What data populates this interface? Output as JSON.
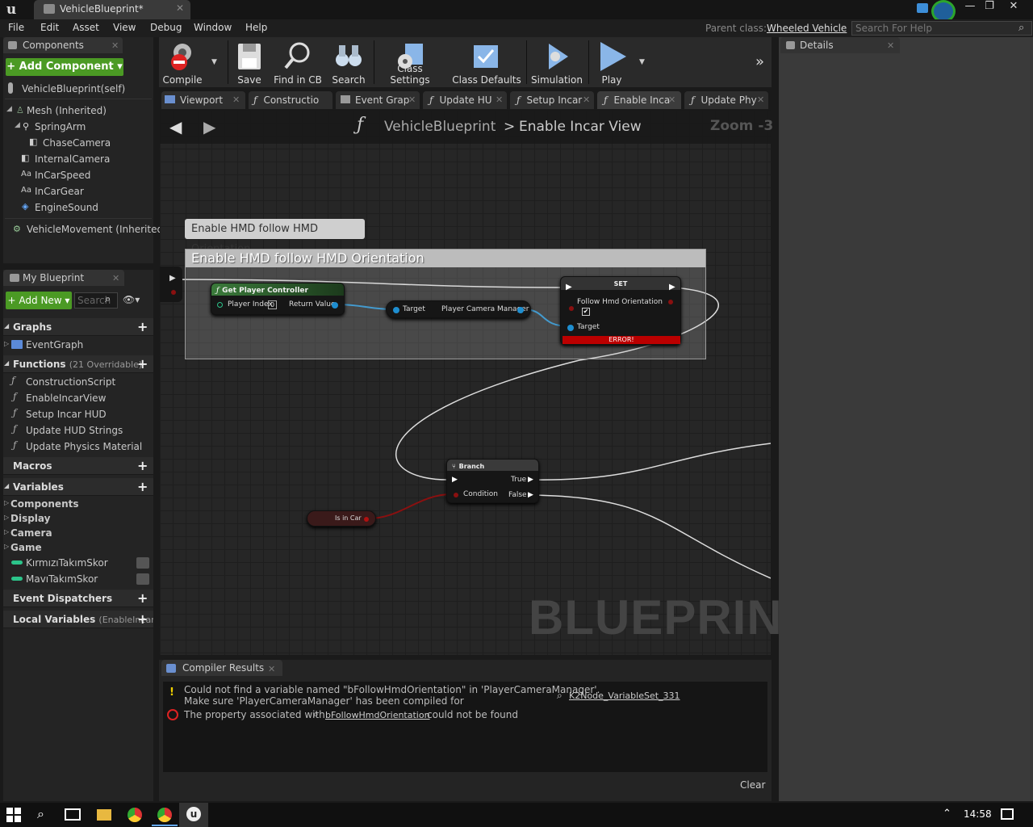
{
  "window": {
    "tab_title": "VehicleBlueprint*",
    "parent_class_label": "Parent class:",
    "parent_class_value": "Wheeled Vehicle",
    "help_search_placeholder": "Search For Help"
  },
  "menu": [
    "File",
    "Edit",
    "Asset",
    "View",
    "Debug",
    "Window",
    "Help"
  ],
  "components_panel": {
    "tab_label": "Components",
    "add_component_label": "+ Add Component ▾",
    "self_label": "VehicleBlueprint(self)",
    "items": [
      "Mesh (Inherited)",
      "SpringArm",
      "ChaseCamera",
      "InternalCamera",
      "InCarSpeed",
      "InCarGear",
      "EngineSound",
      "VehicleMovement (Inherited)"
    ]
  },
  "my_blueprint": {
    "tab_label": "My Blueprint",
    "add_new_label": "+ Add New ▾",
    "search_placeholder": "Search",
    "graphs_header": "Graphs",
    "event_graph": "EventGraph",
    "functions_header": "Functions",
    "functions_count": "(21 Overridable)",
    "functions": [
      "ConstructionScript",
      "EnableIncarView",
      "Setup Incar HUD",
      "Update HUD Strings",
      "Update Physics Material"
    ],
    "macros_header": "Macros",
    "variables_header": "Variables",
    "variable_categories": [
      "Components",
      "Display",
      "Camera",
      "Game"
    ],
    "variables": [
      "KırmızıTakımSkor",
      "MavıTakımSkor"
    ],
    "event_dispatchers_header": "Event Dispatchers",
    "local_variables_header": "Local Variables",
    "local_variables_note": "(EnableIncar"
  },
  "toolbar": {
    "buttons": [
      "Compile",
      "Save",
      "Find in CB",
      "Search",
      "Class Settings",
      "Class Defaults",
      "Simulation",
      "Play"
    ]
  },
  "graph_tabs": [
    "Viewport",
    "Constructio",
    "Event Grap",
    "Update HU",
    "Setup Incar",
    "Enable Inca",
    "Update Phy"
  ],
  "graph": {
    "breadcrumb_root": "VehicleBlueprint",
    "breadcrumb_sep": ">",
    "breadcrumb_current": "Enable Incar View",
    "zoom": "Zoom -3",
    "watermark": "BLUEPRINT",
    "comment_bubble": "Enable HMD follow HMD Orientation",
    "comment_title": "Enable HMD follow HMD Orientation",
    "nodes": {
      "get_player_controller": {
        "title": "Get Player Controller",
        "pin_in": "Player Index",
        "pin_in_value": "0",
        "pin_out": "Return Value"
      },
      "camera_manager": {
        "pin_in": "Target",
        "pin_out": "Player Camera Manager"
      },
      "set": {
        "title": "SET",
        "pin_bool": "Follow Hmd Orientation",
        "pin_target": "Target",
        "error": "ERROR!"
      },
      "branch": {
        "title": "Branch",
        "pin_condition": "Condition",
        "pin_true": "True",
        "pin_false": "False"
      },
      "is_in_car": {
        "label": "Is in Car"
      }
    }
  },
  "compiler": {
    "tab_label": "Compiler Results",
    "warning_line1": "Could not find a variable named \"bFollowHmdOrientation\" in 'PlayerCameraManager'.",
    "warning_line2": "Make sure 'PlayerCameraManager' has been compiled for",
    "warning_link": "K2Node_VariableSet_331",
    "error_prefix": "The property associated with",
    "error_link": "bFollowHmdOrientation",
    "error_suffix": "could not be found",
    "clear_label": "Clear"
  },
  "details": {
    "tab_label": "Details"
  },
  "taskbar": {
    "clock": "14:58"
  }
}
